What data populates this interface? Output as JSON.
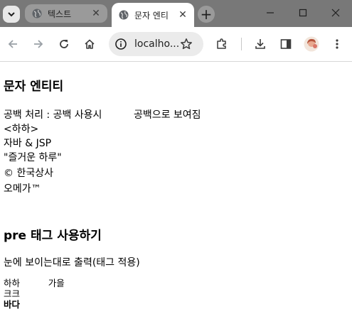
{
  "browser": {
    "tabs": [
      {
        "title": "텍스트",
        "close": "✕",
        "active": false
      },
      {
        "title": "문자 엔티",
        "close": "✕",
        "active": true
      }
    ],
    "new_tab": "+",
    "address_bar": {
      "url": "localho..."
    },
    "icons": {
      "tab_search": "chevron-down-icon",
      "back": "arrow-left-icon",
      "forward": "arrow-right-icon",
      "reload": "reload-icon",
      "home": "home-icon",
      "site_info": "info-icon",
      "bookmark": "star-icon",
      "extensions": "puzzle-icon",
      "downloads": "download-icon",
      "side_panel": "side-panel-icon",
      "profile": "avatar",
      "menu": "kebab-menu-icon"
    },
    "colors": {
      "tab_strip": "#787878",
      "active_tab": "#ffffff",
      "omnibox": "#ebebeb"
    }
  },
  "page": {
    "heading1": "문자 엔티티",
    "lines": [
      "공백 처리 : 공백 사용시          공백으로 보여짐",
      "<하하>",
      "자바 & JSP",
      "\"즐거운 하루\"",
      "© 한국상사",
      "오메가™"
    ],
    "heading2": "pre 태그 사용하기",
    "desc": "눈에 보이는대로 출력(태그 적용)",
    "pre_lines": [
      "하하          가을",
      "크크",
      "바다"
    ]
  }
}
